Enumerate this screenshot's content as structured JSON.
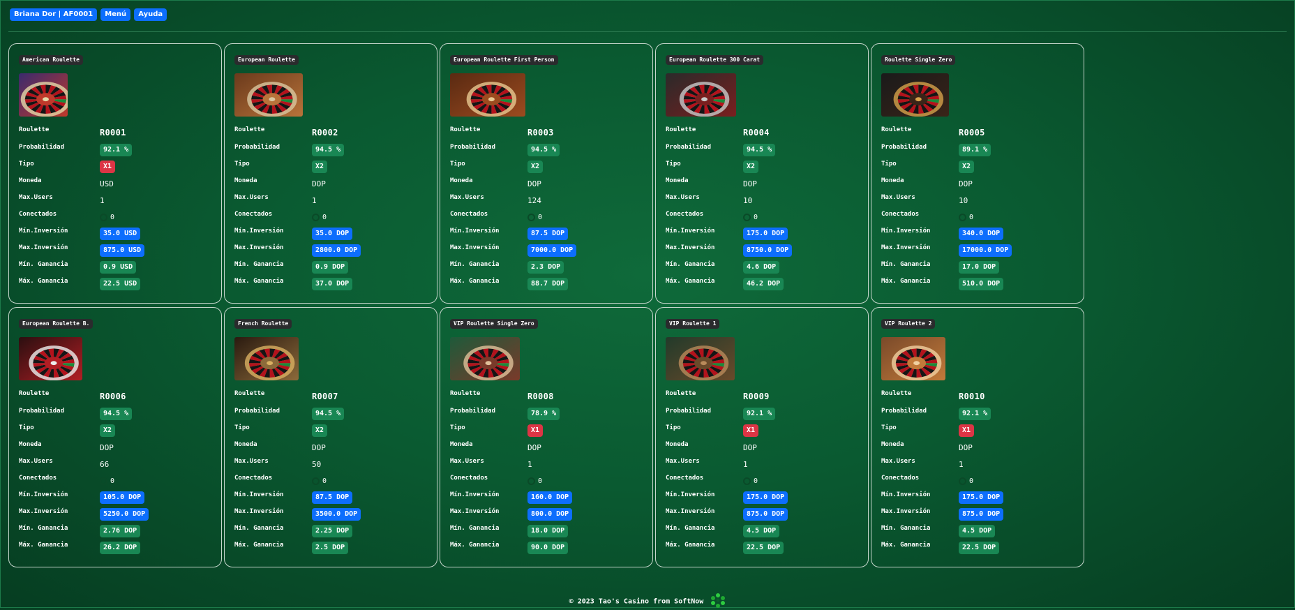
{
  "header": {
    "user_label": "Briana Dor | AF0001",
    "menu_label": "Menú",
    "help_label": "Ayuda"
  },
  "labels": {
    "roulette": "Roulette",
    "probability": "Probabilidad",
    "type": "Tipo",
    "currency": "Moneda",
    "max_users": "Max.Users",
    "connected": "Conectados",
    "min_investment": "Mín.Inversión",
    "max_investment": "Max.Inversión",
    "min_gain": "Mín. Ganancia",
    "max_gain": "Máx. Ganancia"
  },
  "colors": {
    "type_x1": "#dc3545",
    "type_x2": "#198754",
    "investment": "#0d6efd",
    "gain": "#198754"
  },
  "cards": [
    {
      "title": "American Roulette",
      "roulette": "R0001",
      "probability": "92.1 %",
      "type": "X1",
      "currency": "USD",
      "max_users": "1",
      "connected": "0",
      "min_investment": "35.0 USD",
      "max_investment": "875.0 USD",
      "min_gain": "0.9 USD",
      "max_gain": "22.5 USD"
    },
    {
      "title": "European Roulette",
      "roulette": "R0002",
      "probability": "94.5 %",
      "type": "X2",
      "currency": "DOP",
      "max_users": "1",
      "connected": "0",
      "min_investment": "35.0 DOP",
      "max_investment": "2800.0 DOP",
      "min_gain": "0.9 DOP",
      "max_gain": "37.0 DOP"
    },
    {
      "title": "European Roulette First Person",
      "roulette": "R0003",
      "probability": "94.5 %",
      "type": "X2",
      "currency": "DOP",
      "max_users": "124",
      "connected": "0",
      "min_investment": "87.5 DOP",
      "max_investment": "7000.0 DOP",
      "min_gain": "2.3 DOP",
      "max_gain": "88.7 DOP"
    },
    {
      "title": "European Roulette 300 Carat",
      "roulette": "R0004",
      "probability": "94.5 %",
      "type": "X2",
      "currency": "DOP",
      "max_users": "10",
      "connected": "0",
      "min_investment": "175.0 DOP",
      "max_investment": "8750.0 DOP",
      "min_gain": "4.6 DOP",
      "max_gain": "46.2 DOP"
    },
    {
      "title": "Roulette Single Zero",
      "roulette": "R0005",
      "probability": "89.1 %",
      "type": "X2",
      "currency": "DOP",
      "max_users": "10",
      "connected": "0",
      "min_investment": "340.0 DOP",
      "max_investment": "17000.0 DOP",
      "min_gain": "17.0 DOP",
      "max_gain": "510.0 DOP"
    },
    {
      "title": "European Roulette B.",
      "roulette": "R0006",
      "probability": "94.5 %",
      "type": "X2",
      "currency": "DOP",
      "max_users": "66",
      "connected": "0",
      "min_investment": "105.0 DOP",
      "max_investment": "5250.0 DOP",
      "min_gain": "2.76 DOP",
      "max_gain": "26.2 DOP"
    },
    {
      "title": "French Roulette",
      "roulette": "R0007",
      "probability": "94.5 %",
      "type": "X2",
      "currency": "DOP",
      "max_users": "50",
      "connected": "0",
      "min_investment": "87.5 DOP",
      "max_investment": "3500.0 DOP",
      "min_gain": "2.25 DOP",
      "max_gain": "2.5 DOP"
    },
    {
      "title": "VIP Roulette Single Zero",
      "roulette": "R0008",
      "probability": "78.9 %",
      "type": "X1",
      "currency": "DOP",
      "max_users": "1",
      "connected": "0",
      "min_investment": "160.0 DOP",
      "max_investment": "800.0 DOP",
      "min_gain": "18.0 DOP",
      "max_gain": "90.0 DOP"
    },
    {
      "title": "VIP Roulette 1",
      "roulette": "R0009",
      "probability": "92.1 %",
      "type": "X1",
      "currency": "DOP",
      "max_users": "1",
      "connected": "0",
      "min_investment": "175.0 DOP",
      "max_investment": "875.0 DOP",
      "min_gain": "4.5 DOP",
      "max_gain": "22.5 DOP"
    },
    {
      "title": "VIP Roulette 2",
      "roulette": "R0010",
      "probability": "92.1 %",
      "type": "X1",
      "currency": "DOP",
      "max_users": "1",
      "connected": "0",
      "min_investment": "175.0 DOP",
      "max_investment": "875.0 DOP",
      "min_gain": "4.5 DOP",
      "max_gain": "22.5 DOP"
    }
  ],
  "footer": {
    "text": "© 2023 Tao's Casino from SoftNow",
    "logo_icon": "softnow-logo-icon"
  }
}
